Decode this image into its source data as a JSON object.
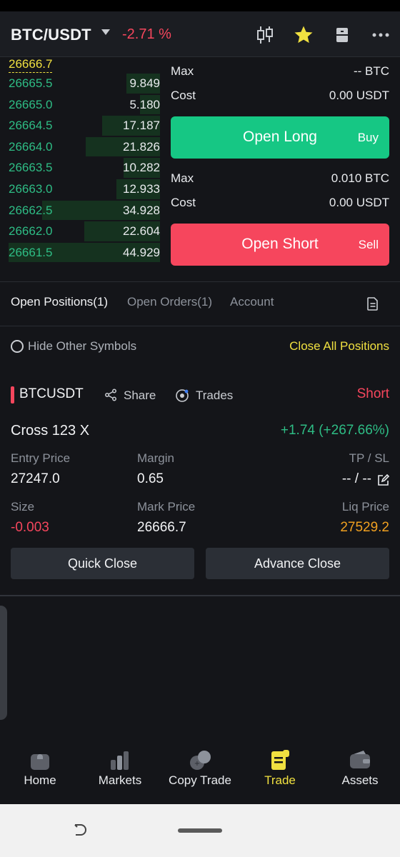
{
  "header": {
    "pair": "BTC/USDT",
    "change": "-2.71 %",
    "icons": [
      "candlestick-chart-icon",
      "star-icon",
      "layout-icon",
      "more-icon"
    ]
  },
  "orderbook": {
    "first_price": "26666.7",
    "rows": [
      {
        "price": "26665.5",
        "qty": "9.849",
        "depth": 0.22
      },
      {
        "price": "26665.0",
        "qty": "5.180",
        "depth": 0.13
      },
      {
        "price": "26664.5",
        "qty": "17.187",
        "depth": 0.38
      },
      {
        "price": "26664.0",
        "qty": "21.826",
        "depth": 0.49
      },
      {
        "price": "26663.5",
        "qty": "10.282",
        "depth": 0.24
      },
      {
        "price": "26663.0",
        "qty": "12.933",
        "depth": 0.29
      },
      {
        "price": "26662.5",
        "qty": "34.928",
        "depth": 0.78
      },
      {
        "price": "26662.0",
        "qty": "22.604",
        "depth": 0.5
      },
      {
        "price": "26661.5",
        "qty": "44.929",
        "depth": 1.0
      }
    ]
  },
  "form": {
    "long": {
      "max_label": "Max",
      "max_value": "-- BTC",
      "cost_label": "Cost",
      "cost_value": "0.00 USDT",
      "button": "Open Long",
      "button_sub": "Buy"
    },
    "short": {
      "max_label": "Max",
      "max_value": "0.010 BTC",
      "cost_label": "Cost",
      "cost_value": "0.00 USDT",
      "button": "Open Short",
      "button_sub": "Sell"
    }
  },
  "tabs": [
    {
      "label": "Open Positions(1)",
      "active": true
    },
    {
      "label": "Open Orders(1)",
      "active": false
    },
    {
      "label": "Account",
      "active": false
    }
  ],
  "filter": {
    "hide_label": "Hide Other Symbols",
    "close_all": "Close All Positions"
  },
  "position": {
    "symbol": "BTCUSDT",
    "share": "Share",
    "trades": "Trades",
    "side": "Short",
    "mode": "Cross 123 X",
    "pnl": "+1.74 (+267.66%)",
    "entry_label": "Entry Price",
    "entry_value": "27247.0",
    "margin_label": "Margin",
    "margin_value": "0.65",
    "tpsl_label": "TP / SL",
    "tpsl_value": "-- / --",
    "size_label": "Size",
    "size_value": "-0.003",
    "mark_label": "Mark Price",
    "mark_value": "26666.7",
    "liq_label": "Liq Price",
    "liq_value": "27529.2",
    "quick_close": "Quick Close",
    "advance_close": "Advance Close"
  },
  "navbar": [
    {
      "label": "Home",
      "icon": "home-icon",
      "active": false
    },
    {
      "label": "Markets",
      "icon": "markets-icon",
      "active": false
    },
    {
      "label": "Copy Trade",
      "icon": "copy-trade-icon",
      "active": false
    },
    {
      "label": "Trade",
      "icon": "trade-icon",
      "active": true
    },
    {
      "label": "Assets",
      "icon": "wallet-icon",
      "active": false
    }
  ],
  "colors": {
    "buy": "#16c784",
    "sell": "#f6465d",
    "accent": "#f0e040",
    "liq": "#f0a020"
  }
}
